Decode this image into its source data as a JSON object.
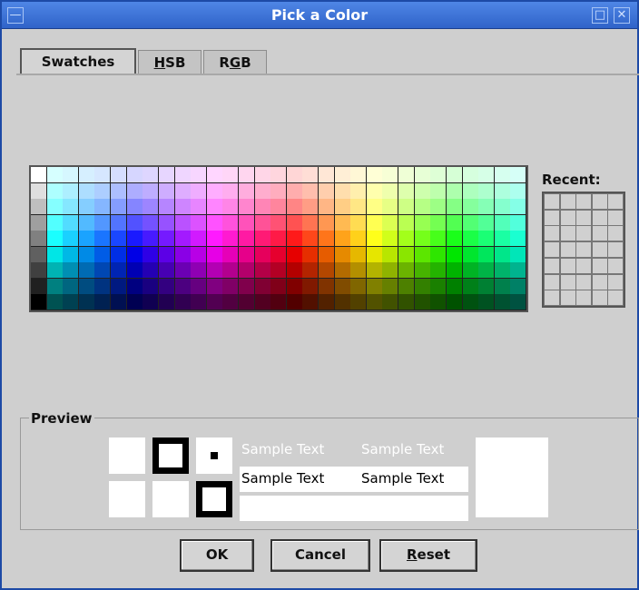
{
  "window": {
    "title": "Pick a Color"
  },
  "tabs": [
    {
      "label": "Swatches",
      "active": true
    },
    {
      "label": "HSB",
      "underline": "H",
      "rest": "SB"
    },
    {
      "label": "RGB",
      "pre": "R",
      "underline": "G",
      "post": "B"
    }
  ],
  "swatches": {
    "columns": 31,
    "rows": 9
  },
  "recent": {
    "label": "Recent:",
    "columns": 5,
    "rows": 7
  },
  "preview": {
    "label": "Preview",
    "sample_text": "Sample Text",
    "colors": {
      "fg": "#ffffff",
      "bg": "#ffffff"
    }
  },
  "buttons": {
    "ok": "OK",
    "cancel": "Cancel",
    "reset_underline": "R",
    "reset_rest": "eset"
  }
}
